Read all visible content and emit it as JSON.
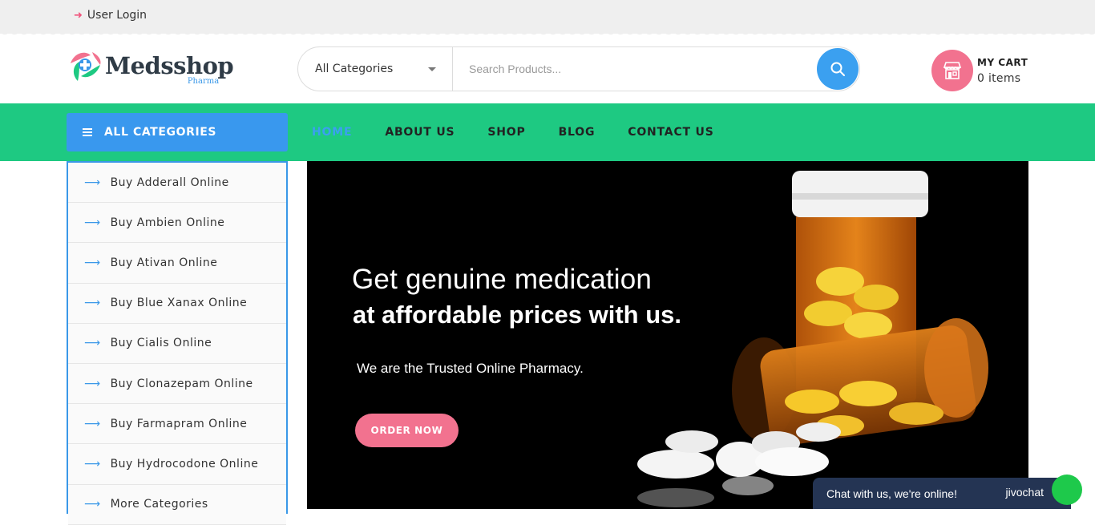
{
  "topbar": {
    "login_label": "User Login"
  },
  "logo": {
    "name": "Medsshop",
    "sub": "Pharma"
  },
  "search": {
    "category_selected": "All Categories",
    "placeholder": "Search Products..."
  },
  "cart": {
    "title": "MY CART",
    "items": "0 items"
  },
  "nav": {
    "all_categories_label": "ALL CATEGORIES",
    "items": [
      {
        "label": "HOME",
        "active": true
      },
      {
        "label": "ABOUT US"
      },
      {
        "label": "SHOP"
      },
      {
        "label": "BLOG"
      },
      {
        "label": "CONTACT US"
      }
    ]
  },
  "sidebar": {
    "items": [
      {
        "label": "Buy Adderall Online"
      },
      {
        "label": "Buy Ambien Online"
      },
      {
        "label": "Buy Ativan Online"
      },
      {
        "label": "Buy Blue Xanax Online"
      },
      {
        "label": "Buy Cialis Online"
      },
      {
        "label": "Buy Clonazepam Online"
      },
      {
        "label": "Buy Farmapram Online"
      },
      {
        "label": "Buy Hydrocodone Online"
      },
      {
        "label": "More Categories"
      }
    ]
  },
  "hero": {
    "headline_1": "Get genuine medication",
    "headline_2": "at affordable prices with us.",
    "subtitle": "We are the Trusted Online Pharmacy.",
    "cta": "ORDER NOW"
  },
  "chat": {
    "message": "Chat with us, we're online!",
    "brand": "jivochat"
  },
  "colors": {
    "accent_green": "#1ec982",
    "accent_blue": "#3998ee",
    "accent_pink": "#f2728f",
    "chat_bg": "#243453"
  },
  "icons": [
    "sign-in-icon",
    "search-icon",
    "shop-icon",
    "menu-bars-icon",
    "arrow-right-icon",
    "caret-down-icon"
  ]
}
